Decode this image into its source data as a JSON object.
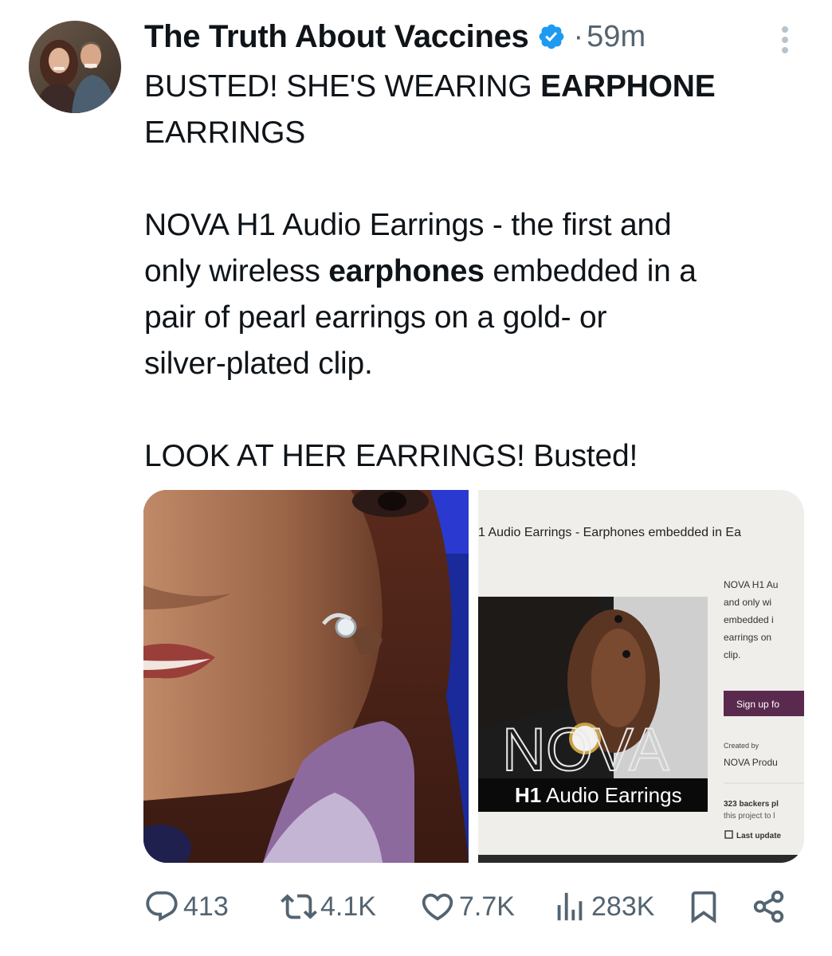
{
  "tweet": {
    "author_name": "The Truth About Vaccines",
    "separator": "·",
    "timestamp": "59m",
    "line1_prefix": "BUSTED! SHE'S WEARING ",
    "line1_bold": "EARPHONE",
    "line2": "EARRINGS",
    "para2_line1": "NOVA H1 Audio Earrings - the first and",
    "para2_line2_prefix": "only wireless ",
    "para2_line2_bold": "earphones",
    "para2_line2_suffix": " embedded in a",
    "para2_line3": "pair of pearl earrings on a gold- or",
    "para2_line4": "silver-plated clip.",
    "para3": "LOOK AT HER EARRINGS! Busted!"
  },
  "media": {
    "right": {
      "page_title": "1 Audio Earrings - Earphones embedded in Ea",
      "desc_lines": [
        "NOVA H1 Au",
        "and only wi",
        "embedded i",
        "earrings on",
        "clip."
      ],
      "signup_button": "Sign up fo",
      "created_by_label": "Created by",
      "creator": "NOVA Produ",
      "backers_line1": "323 backers pl",
      "backers_line2": "this project to l",
      "last_updated": "Last update",
      "logo_text": "NOVA",
      "banner_bold": "H1",
      "banner_text": " Audio Earrings"
    }
  },
  "actions": {
    "replies": "413",
    "reposts": "4.1K",
    "likes": "7.7K",
    "views": "283K"
  },
  "colors": {
    "text": "#0f1419",
    "secondary": "#536471",
    "verified": "#1d9bf0",
    "button_purple": "#5a2a4e"
  },
  "icons": [
    "verified-badge-icon",
    "more-icon",
    "reply-icon",
    "repost-icon",
    "like-icon",
    "views-icon",
    "bookmark-icon",
    "share-icon"
  ]
}
